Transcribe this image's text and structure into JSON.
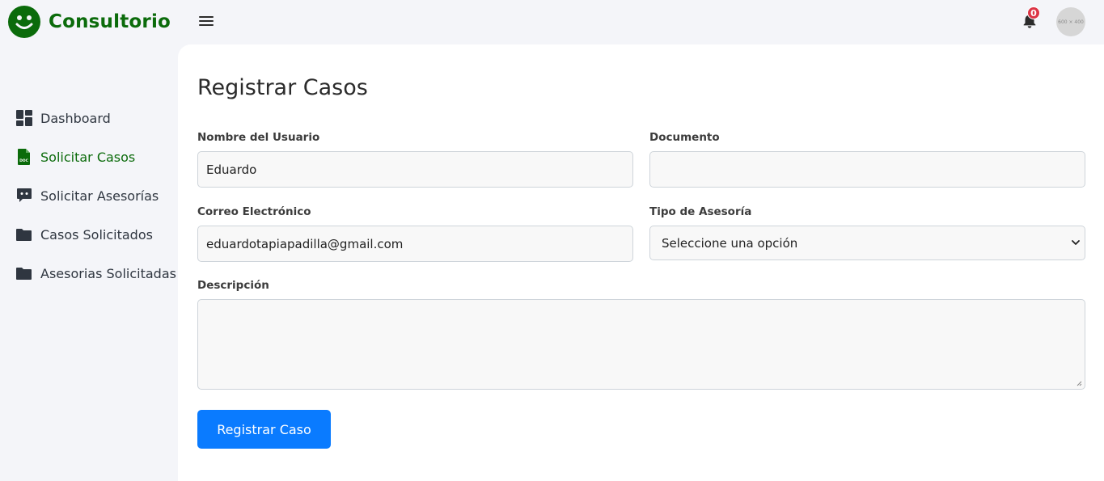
{
  "brand": {
    "name": "Consultorio",
    "logo_icon": "smiley-face-icon"
  },
  "topbar": {
    "menu_icon": "hamburger-menu-icon",
    "notifications": {
      "icon": "bell-icon",
      "count": "0"
    },
    "avatar_placeholder": "600 × 400"
  },
  "sidebar": {
    "items": [
      {
        "label": "Dashboard",
        "icon": "dashboard-icon",
        "active": false
      },
      {
        "label": "Solicitar Casos",
        "icon": "document-icon",
        "active": true
      },
      {
        "label": "Solicitar Asesorías",
        "icon": "chat-icon",
        "active": false
      },
      {
        "label": "Casos Solicitados",
        "icon": "folder-icon",
        "active": false
      },
      {
        "label": "Asesorias Solicitadas",
        "icon": "folder-icon",
        "active": false
      }
    ]
  },
  "form": {
    "title": "Registrar Casos",
    "nombre": {
      "label": "Nombre del Usuario",
      "value": "Eduardo"
    },
    "documento": {
      "label": "Documento",
      "value": ""
    },
    "correo": {
      "label": "Correo Electrónico",
      "value": "eduardotapiapadilla@gmail.com"
    },
    "tipo": {
      "label": "Tipo de Asesoría",
      "selected": "Seleccione una opción"
    },
    "descripcion": {
      "label": "Descripción",
      "value": ""
    },
    "submit_label": "Registrar Caso"
  },
  "colors": {
    "brand_green": "#0b6b0b",
    "primary_blue": "#0a7bff",
    "badge_red": "#dc3545",
    "sidebar_bg": "#f4f5f9"
  }
}
